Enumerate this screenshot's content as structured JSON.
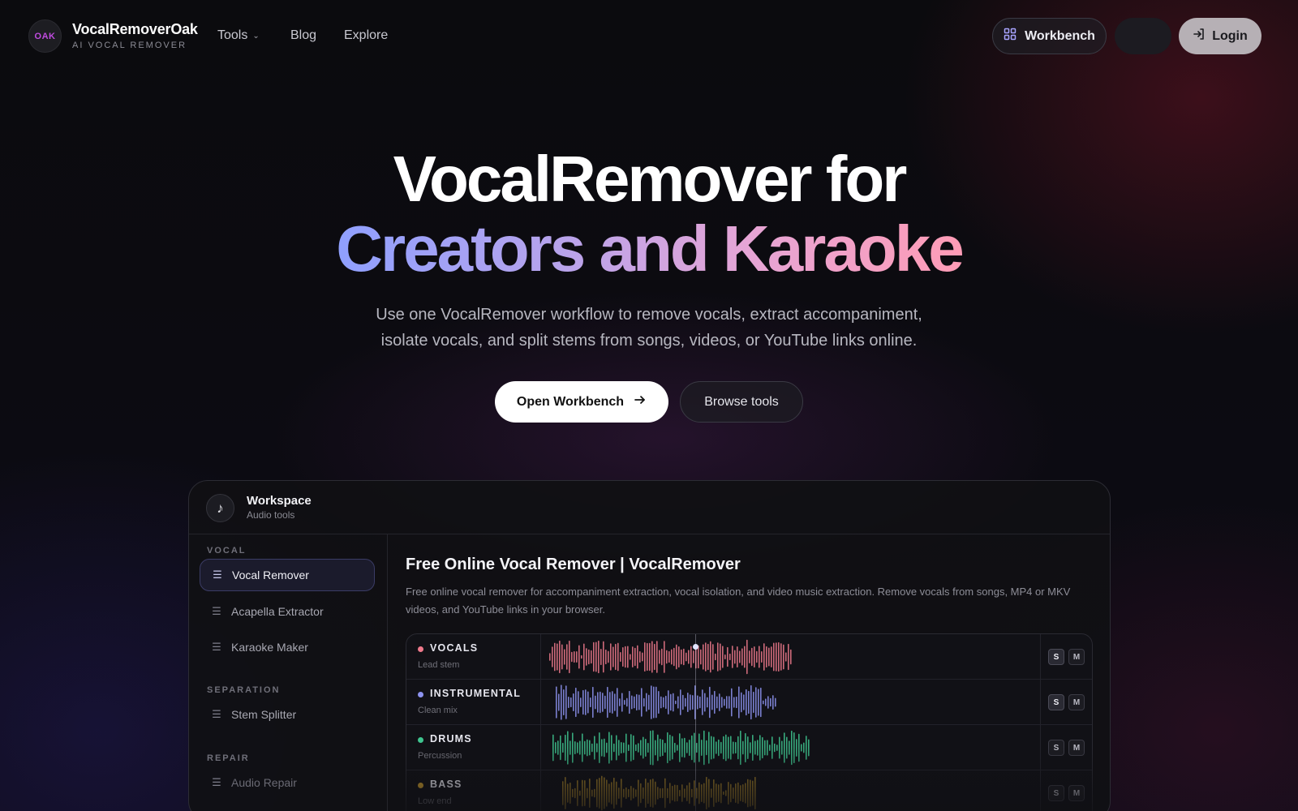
{
  "nav": {
    "logo_text": "OAK",
    "brand_name": "VocalRemoverOak",
    "brand_sub": "AI VOCAL REMOVER",
    "links": [
      {
        "label": "Tools",
        "has_dropdown": true
      },
      {
        "label": "Blog"
      },
      {
        "label": "Explore"
      }
    ],
    "workbench_label": "Workbench",
    "login_label": "Login"
  },
  "hero": {
    "title_line1": "VocalRemover for",
    "title_line2": "Creators and Karaoke",
    "subtitle_line1": "Use one VocalRemover workflow to remove vocals, extract accompaniment,",
    "subtitle_line2": "isolate vocals, and split stems from songs, videos, or YouTube links online.",
    "primary_cta": "Open Workbench",
    "secondary_cta": "Browse tools"
  },
  "workspace": {
    "title": "Workspace",
    "subtitle": "Audio tools",
    "sections": [
      {
        "label": "VOCAL",
        "items": [
          "Vocal Remover",
          "Acapella Extractor",
          "Karaoke Maker"
        ]
      },
      {
        "label": "SEPARATION",
        "items": [
          "Stem Splitter"
        ]
      },
      {
        "label": "REPAIR",
        "items": [
          "Audio Repair"
        ]
      }
    ],
    "active_item": "Vocal Remover",
    "tool_title": "Free Online Vocal Remover | VocalRemover",
    "tool_desc": "Free online vocal remover for accompaniment extraction, vocal isolation, and video music extraction. Remove vocals from songs, MP4 or MKV videos, and YouTube links in your browser.",
    "tracks": [
      {
        "name": "VOCALS",
        "sub": "Lead stem",
        "color": "#f07a8c",
        "solo_label": "S",
        "mute_label": "M",
        "solo_on": true
      },
      {
        "name": "INSTRUMENTAL",
        "sub": "Clean mix",
        "color": "#8d93f0",
        "solo_label": "S",
        "mute_label": "M",
        "solo_on": true
      },
      {
        "name": "DRUMS",
        "sub": "Percussion",
        "color": "#3fc58f",
        "solo_label": "S",
        "mute_label": "M",
        "solo_on": false
      },
      {
        "name": "BASS",
        "sub": "Low end",
        "color": "#c89b2e",
        "solo_label": "S",
        "mute_label": "M",
        "solo_on": false
      }
    ]
  },
  "colors": {
    "accent_gradient_start": "#8fa0ff",
    "accent_gradient_end": "#ff9cb6",
    "logo_color": "#c04be0"
  }
}
